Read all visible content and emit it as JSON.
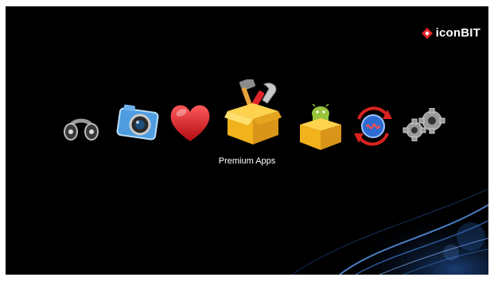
{
  "brand": {
    "name": "iconBIT"
  },
  "menu": {
    "items": [
      {
        "id": "music",
        "icon": "headphones-icon"
      },
      {
        "id": "photo",
        "icon": "camera-icon"
      },
      {
        "id": "favorites",
        "icon": "heart-icon"
      },
      {
        "id": "premium-apps",
        "icon": "toolbox-icon",
        "label": "Premium Apps",
        "selected": true
      },
      {
        "id": "android-apps",
        "icon": "android-box-icon"
      },
      {
        "id": "sync",
        "icon": "sync-icon"
      },
      {
        "id": "settings",
        "icon": "gears-icon"
      }
    ]
  },
  "caption": "Premium Apps",
  "colors": {
    "background": "#000000",
    "accent_red": "#e0242a",
    "box_gold": "#f2b21c",
    "swirl_blue": "#3f7fd6"
  }
}
